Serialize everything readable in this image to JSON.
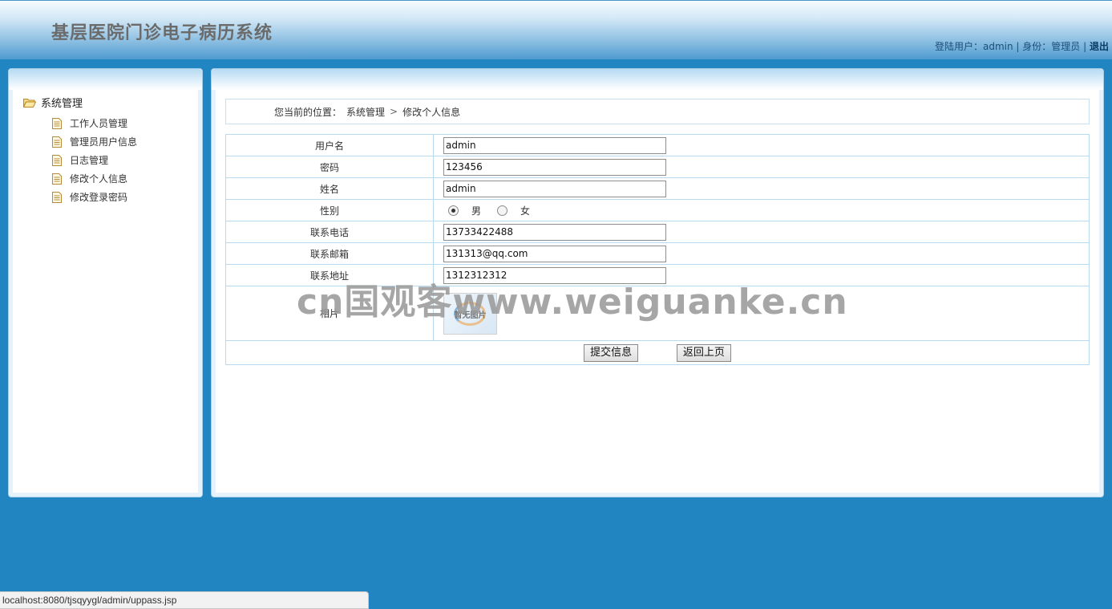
{
  "header": {
    "title": "基层医院门诊电子病历系统",
    "user_prefix": "登陆用户：",
    "username": "admin",
    "sep1": " | ",
    "role_prefix": "身份：",
    "role": "管理员",
    "sep2": " | ",
    "logout": "退出"
  },
  "sidebar": {
    "root": "系统管理",
    "items": [
      {
        "label": "工作人员管理"
      },
      {
        "label": "管理员用户信息"
      },
      {
        "label": "日志管理"
      },
      {
        "label": "修改个人信息"
      },
      {
        "label": "修改登录密码"
      }
    ]
  },
  "breadcrumb": {
    "prefix": "您当前的位置：",
    "level1": "系统管理",
    "sep": ">",
    "level2": "修改个人信息"
  },
  "form": {
    "username": {
      "label": "用户名",
      "value": "admin"
    },
    "password": {
      "label": "密码",
      "value": "123456"
    },
    "name": {
      "label": "姓名",
      "value": "admin"
    },
    "gender": {
      "label": "性别",
      "option_male": "男",
      "option_female": "女",
      "selected": "男"
    },
    "phone": {
      "label": "联系电话",
      "value": "13733422488"
    },
    "email": {
      "label": "联系邮箱",
      "value": "131313@qq.com"
    },
    "address": {
      "label": "联系地址",
      "value": "1312312312"
    },
    "photo": {
      "label": "相片",
      "placeholder_text": "暂无图片"
    },
    "submit_label": "提交信息",
    "back_label": "返回上页"
  },
  "watermark": "cn国观客www.weiguanke.cn",
  "statusbar": {
    "url": "localhost:8080/tjsqyygl/admin/uppass.jsp"
  },
  "colors": {
    "background": "#2185c1",
    "panel_border": "#a6cfea",
    "table_border": "#b9d9ee"
  }
}
